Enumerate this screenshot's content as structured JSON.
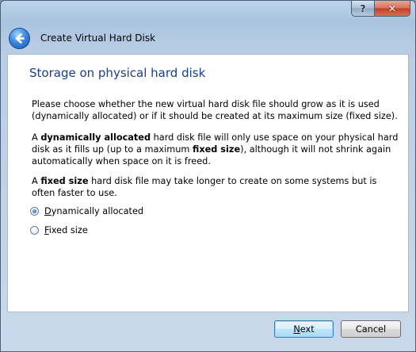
{
  "window": {
    "help_label": "?",
    "close_label": "✕"
  },
  "header": {
    "back_icon": "back-arrow-icon",
    "title": "Create Virtual Hard Disk"
  },
  "page": {
    "heading": "Storage on physical hard disk",
    "para1": "Please choose whether the new virtual hard disk file should grow as it is used (dynamically allocated) or if it should be created at its maximum size (fixed size).",
    "para2": {
      "t1": "A ",
      "b1": "dynamically allocated",
      "t2": " hard disk file will only use space on your physical hard disk as it fills up (up to a maximum ",
      "b2": "fixed size",
      "t3": "), although it will not shrink again automatically when space on it is freed."
    },
    "para3": {
      "t1": "A ",
      "b1": "fixed size",
      "t2": " hard disk file may take longer to create on some systems but is often faster to use."
    }
  },
  "options": [
    {
      "label_mnemonic": "D",
      "label_rest": "ynamically allocated",
      "selected": true
    },
    {
      "label_mnemonic": "F",
      "label_rest": "ixed size",
      "selected": false
    }
  ],
  "buttons": {
    "next_mnemonic": "N",
    "next_rest": "ext",
    "cancel_label": "Cancel"
  },
  "colors": {
    "heading": "#1a3e8c",
    "next_border": "#3c7fb1"
  }
}
